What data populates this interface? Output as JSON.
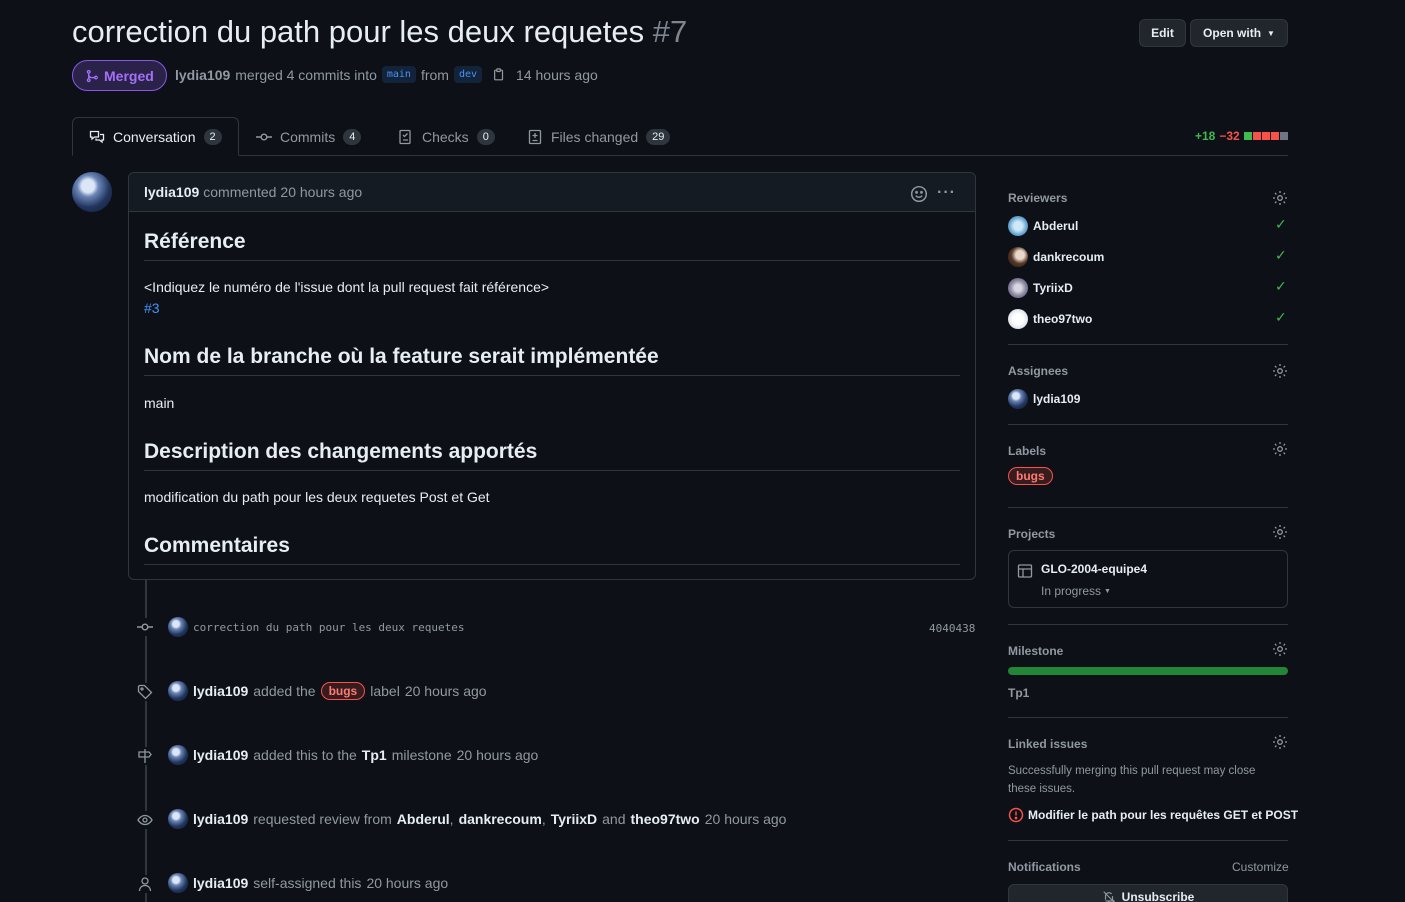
{
  "header": {
    "title": "correction du path pour les deux requetes",
    "number": "#7",
    "edit_label": "Edit",
    "open_with_label": "Open with",
    "status": "Merged",
    "author": "lydia109",
    "merge_text": "merged 4 commits into",
    "base_branch": "main",
    "from_text": "from",
    "head_branch": "dev",
    "time": "14 hours ago"
  },
  "tabs": [
    {
      "label": "Conversation",
      "count": "2"
    },
    {
      "label": "Commits",
      "count": "4"
    },
    {
      "label": "Checks",
      "count": "0"
    },
    {
      "label": "Files changed",
      "count": "29"
    }
  ],
  "diffstat": {
    "additions": "+18",
    "deletions": "−32"
  },
  "comment": {
    "author": "lydia109",
    "action": "commented",
    "time": "20 hours ago",
    "h_reference": "Référence",
    "p_reference": "<Indiquez le numéro de l'issue dont la pull request fait référence>",
    "issue_link": "#3",
    "h_branch": "Nom de la branche où la feature serait implémentée",
    "p_branch": "main",
    "h_description": "Description des changements apportés",
    "p_description": "modification du path pour les deux requetes Post et Get",
    "h_comments": "Commentaires"
  },
  "timeline": {
    "commit_msg": "correction du path pour les deux requetes",
    "commit_sha": "4040438",
    "ev1_user": "lydia109",
    "ev1_pre": "added the",
    "ev1_label": "bugs",
    "ev1_post": "label",
    "ev1_time": "20 hours ago",
    "ev2_user": "lydia109",
    "ev2_pre": "added this to the",
    "ev2_milestone": "Tp1",
    "ev2_post": "milestone",
    "ev2_time": "20 hours ago",
    "ev3_user": "lydia109",
    "ev3_pre": "requested review from",
    "ev3_r1": "Abderul",
    "ev3_r2": "dankrecoum",
    "ev3_r3": "TyriixD",
    "ev3_and": "and",
    "ev3_r4": "theo97two",
    "ev3_time": "20 hours ago",
    "ev4_user": "lydia109",
    "ev4_pre": "self-assigned this",
    "ev4_time": "20 hours ago"
  },
  "sidebar": {
    "reviewers_title": "Reviewers",
    "reviewers": [
      "Abderul",
      "dankrecoum",
      "TyriixD",
      "theo97two"
    ],
    "assignees_title": "Assignees",
    "assignee": "lydia109",
    "labels_title": "Labels",
    "label": "bugs",
    "projects_title": "Projects",
    "project_name": "GLO-2004-equipe4",
    "project_status": "In progress",
    "milestone_title": "Milestone",
    "milestone_progress": 1.0,
    "milestone": "Tp1",
    "linked_title": "Linked issues",
    "linked_desc": "Successfully merging this pull request may close these issues.",
    "linked_issue": "Modifier le path pour les requêtes GET et POST",
    "notifications_title": "Notifications",
    "customize": "Customize",
    "unsubscribe": "Unsubscribe"
  },
  "colors": {
    "merged": "#a371f7",
    "add": "#3fb950",
    "del": "#f85149",
    "link": "#4493f8"
  }
}
